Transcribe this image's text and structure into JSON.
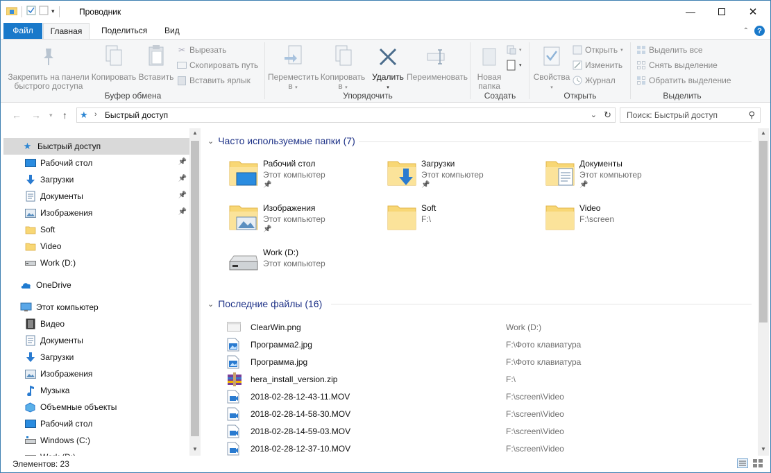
{
  "window": {
    "title": "Проводник"
  },
  "tabs": {
    "file": "Файл",
    "home": "Главная",
    "share": "Поделиться",
    "view": "Вид"
  },
  "ribbon": {
    "clipboard": {
      "label": "Буфер обмена",
      "pin_line1": "Закрепить на панели",
      "pin_line2": "быстрого доступа",
      "copy": "Копировать",
      "paste": "Вставить",
      "cut": "Вырезать",
      "copy_path": "Скопировать путь",
      "paste_shortcut": "Вставить ярлык"
    },
    "organize": {
      "label": "Упорядочить",
      "move_line1": "Переместить",
      "move_line2": "в",
      "copy_line1": "Копировать",
      "copy_line2": "в",
      "delete": "Удалить",
      "rename": "Переименовать"
    },
    "new": {
      "label": "Создать",
      "new_folder_line1": "Новая",
      "new_folder_line2": "папка"
    },
    "open": {
      "label": "Открыть",
      "properties": "Свойства",
      "open": "Открыть",
      "edit": "Изменить",
      "history": "Журнал"
    },
    "select": {
      "label": "Выделить",
      "select_all": "Выделить все",
      "select_none": "Снять выделение",
      "invert": "Обратить выделение"
    }
  },
  "address": {
    "path": "Быстрый доступ",
    "search_placeholder": "Поиск: Быстрый доступ"
  },
  "nav": {
    "quick_access": "Быстрый доступ",
    "qa_items": [
      "Рабочий стол",
      "Загрузки",
      "Документы",
      "Изображения",
      "Soft",
      "Video",
      "Work (D:)"
    ],
    "onedrive": "OneDrive",
    "this_pc": "Этот компьютер",
    "pc_items": [
      "Видео",
      "Документы",
      "Загрузки",
      "Изображения",
      "Музыка",
      "Объемные объекты",
      "Рабочий стол",
      "Windows (C:)",
      "Work (D:)"
    ]
  },
  "frequent": {
    "header": "Часто используемые папки (7)",
    "tiles": [
      {
        "name": "Рабочий стол",
        "sub": "Этот компьютер"
      },
      {
        "name": "Загрузки",
        "sub": "Этот компьютер"
      },
      {
        "name": "Документы",
        "sub": "Этот компьютер"
      },
      {
        "name": "Изображения",
        "sub": "Этот компьютер"
      },
      {
        "name": "Soft",
        "sub": "F:\\"
      },
      {
        "name": "Video",
        "sub": "F:\\screen"
      },
      {
        "name": "Work (D:)",
        "sub": "Этот компьютер"
      }
    ]
  },
  "recent": {
    "header": "Последние файлы (16)",
    "files": [
      {
        "name": "ClearWin.png",
        "path": "Work (D:)"
      },
      {
        "name": "Программа2.jpg",
        "path": "F:\\Фото клавиатура"
      },
      {
        "name": "Программа.jpg",
        "path": "F:\\Фото клавиатура"
      },
      {
        "name": "hera_install_version.zip",
        "path": "F:\\"
      },
      {
        "name": "2018-02-28-12-43-11.MOV",
        "path": "F:\\screen\\Video"
      },
      {
        "name": "2018-02-28-14-58-30.MOV",
        "path": "F:\\screen\\Video"
      },
      {
        "name": "2018-02-28-14-59-03.MOV",
        "path": "F:\\screen\\Video"
      },
      {
        "name": "2018-02-28-12-37-10.MOV",
        "path": "F:\\screen\\Video"
      }
    ]
  },
  "status": {
    "count": "Элементов: 23"
  },
  "colors": {
    "accent": "#1979ca",
    "folder": "#f8d775",
    "header_text": "#1e3287"
  }
}
